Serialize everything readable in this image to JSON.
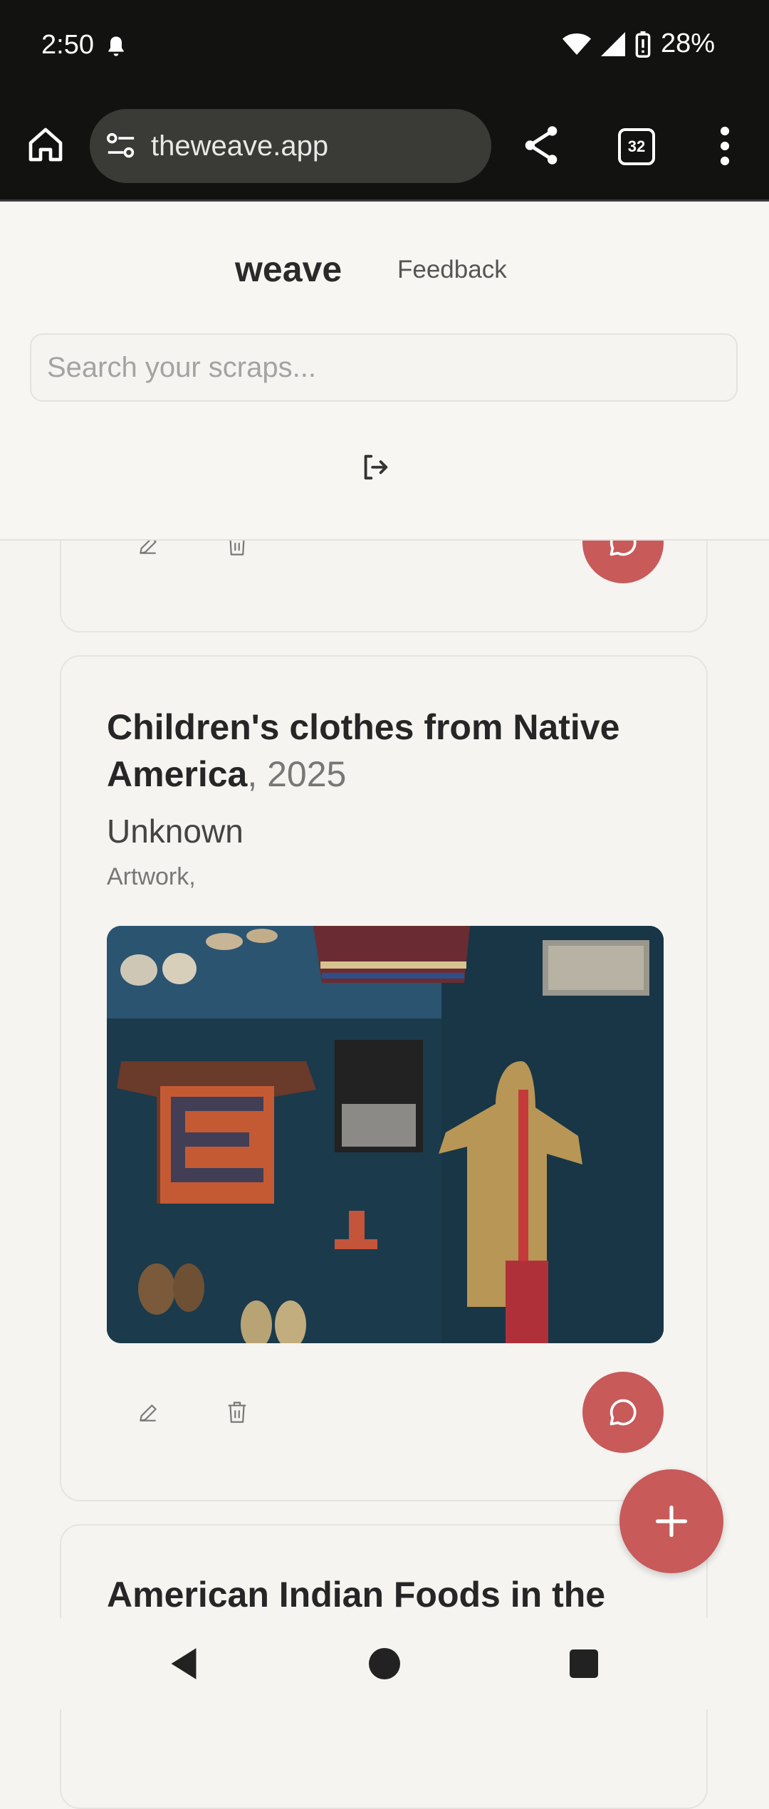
{
  "status": {
    "time": "2:50",
    "battery": "28%"
  },
  "browser": {
    "url": "theweave.app",
    "tab_count": "32"
  },
  "header": {
    "brand": "weave",
    "feedback": "Feedback",
    "search_placeholder": "Search your scraps..."
  },
  "card": {
    "title": "Children's clothes from Native America",
    "year": ", 2025",
    "author": "Unknown",
    "type": "Artwork,"
  },
  "next_card": {
    "title": "American Indian Foods in the"
  },
  "icons": {
    "home": "home-icon",
    "tune": "site-settings-icon",
    "share": "share-icon",
    "menu": "more-vert-icon",
    "logout": "logout-icon",
    "edit": "pencil-icon",
    "delete": "trash-icon",
    "comment": "chat-bubble-icon",
    "add": "plus-icon"
  },
  "colors": {
    "accent": "#c85a5a",
    "status_bar": "#121310",
    "background": "#f5f4f1"
  }
}
